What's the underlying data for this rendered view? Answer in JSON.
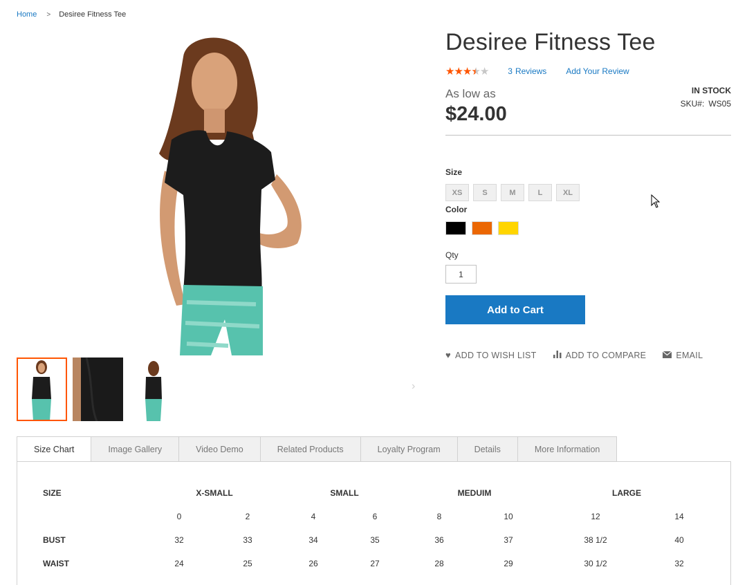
{
  "breadcrumb": {
    "home": "Home",
    "separator": ">",
    "current": "Desiree Fitness Tee"
  },
  "product": {
    "title": "Desiree Fitness Tee",
    "rating": {
      "filled": 3.5,
      "max": 5,
      "reviews_count": "3",
      "reviews_label": "Reviews",
      "add_review": "Add Your Review"
    },
    "price_prefix": "As low as",
    "price": "$24.00",
    "stock": "IN STOCK",
    "sku_label": "SKU#:",
    "sku": "WS05"
  },
  "options": {
    "size_label": "Size",
    "sizes": [
      "XS",
      "S",
      "M",
      "L",
      "XL"
    ],
    "color_label": "Color",
    "colors": [
      {
        "name": "Black",
        "hex": "#000000"
      },
      {
        "name": "Orange",
        "hex": "#eb6703"
      },
      {
        "name": "Yellow",
        "hex": "#ffd500"
      }
    ],
    "qty_label": "Qty",
    "qty_value": "1"
  },
  "actions": {
    "add_to_cart": "Add to Cart",
    "wishlist": "ADD TO WISH LIST",
    "compare": "ADD TO COMPARE",
    "email": "EMAIL"
  },
  "icons": {
    "wishlist": "heart-icon",
    "compare": "bar-chart-icon",
    "email": "envelope-icon",
    "gallery_next": "chevron-right-icon",
    "breadcrumb_sep": "chevron-right-icon",
    "cursor": "mouse-pointer-icon"
  },
  "tabs": [
    "Size Chart",
    "Image Gallery",
    "Video Demo",
    "Related Products",
    "Loyalty Program",
    "Details",
    "More Information"
  ],
  "size_chart": {
    "header": [
      "SIZE",
      "X-SMALL",
      "SMALL",
      "MEDUIM",
      "LARGE"
    ],
    "numbers": [
      "0",
      "2",
      "4",
      "6",
      "8",
      "10",
      "12",
      "14"
    ],
    "rows": [
      {
        "label": "BUST",
        "values": [
          "32",
          "33",
          "34",
          "35",
          "36",
          "37",
          "38 1/2",
          "40"
        ]
      },
      {
        "label": "WAIST",
        "values": [
          "24",
          "25",
          "26",
          "27",
          "28",
          "29",
          "30 1/2",
          "32"
        ]
      }
    ]
  },
  "colors": {
    "accent": "#1979c3",
    "star": "#ff5501",
    "active_thumb": "#ff5501"
  }
}
